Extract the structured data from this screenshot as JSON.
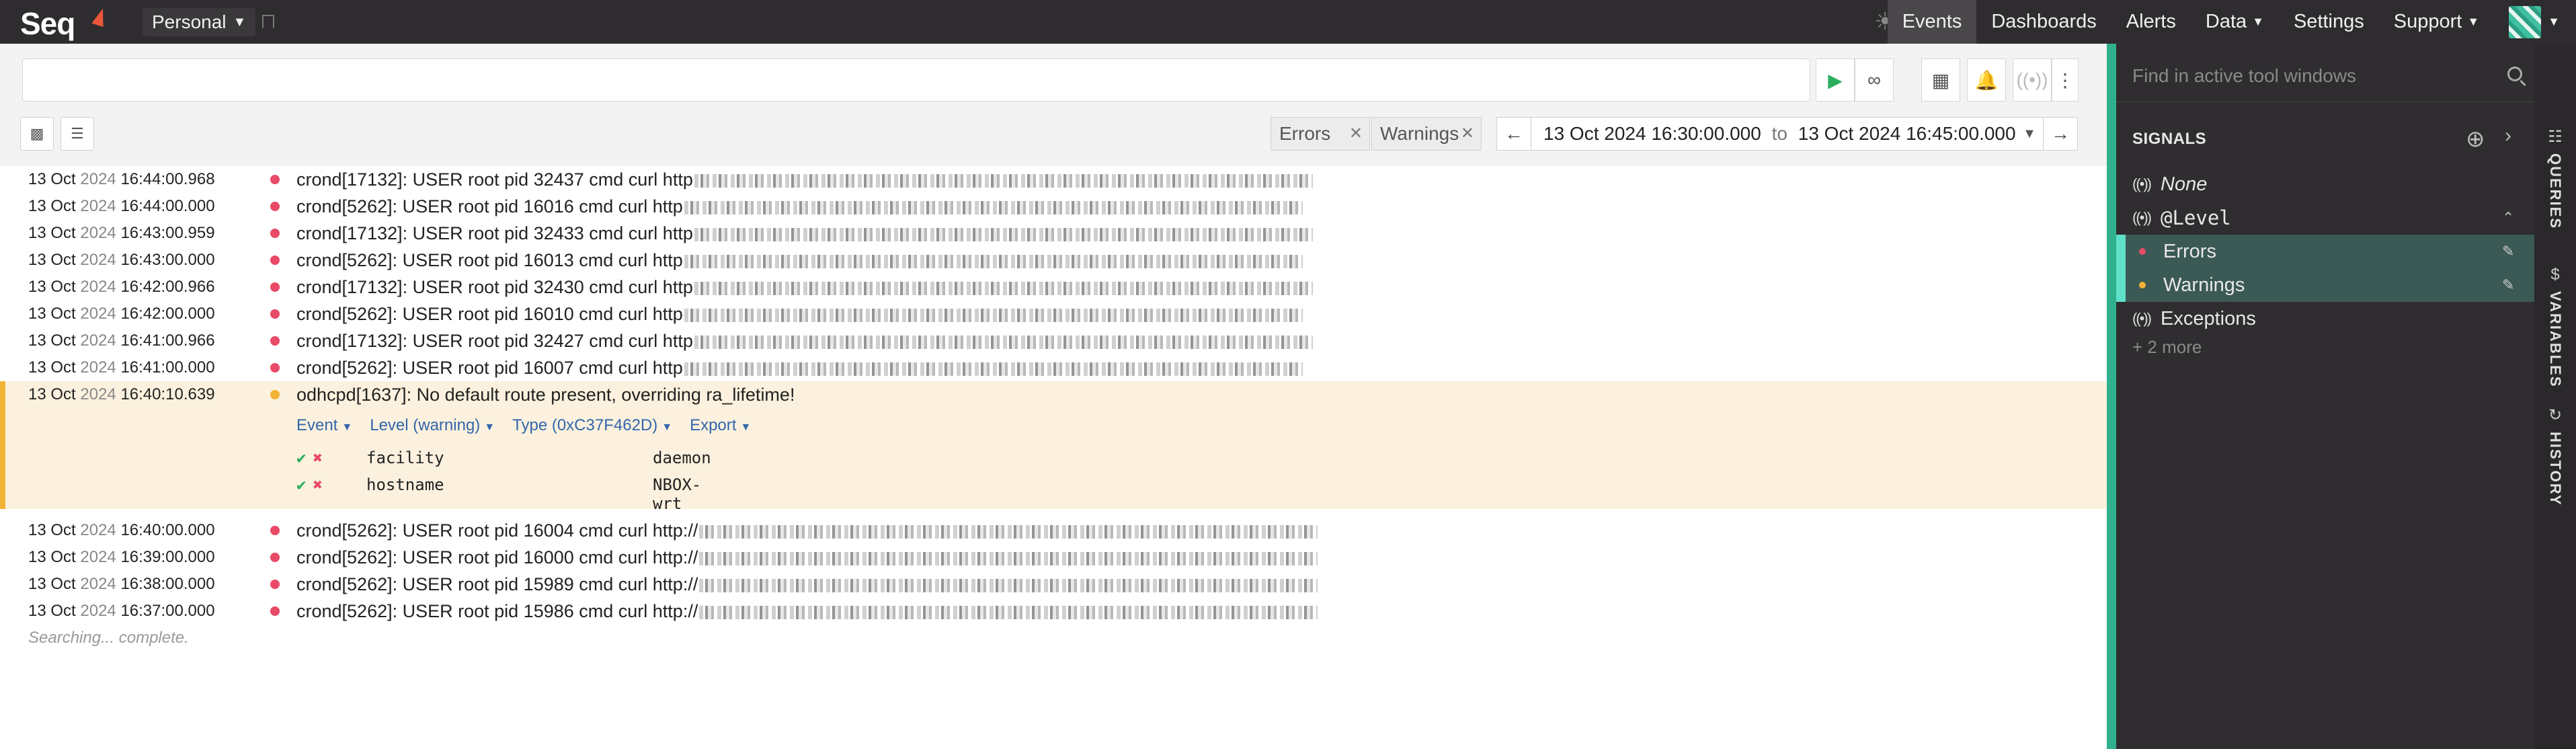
{
  "app": {
    "logo": "Seq",
    "workspace": "Personal"
  },
  "nav": {
    "events": "Events",
    "dashboards": "Dashboards",
    "alerts": "Alerts",
    "data": "Data",
    "settings": "Settings",
    "support": "Support"
  },
  "filters": {
    "search_value": "",
    "chip_errors": "Errors",
    "chip_warnings": "Warnings",
    "range_from": "13 Oct 2024 16:30:00.000",
    "range_to_word": "to",
    "range_to": "13 Oct 2024 16:45:00.000"
  },
  "events": [
    {
      "date": "13 Oct",
      "year": "2024",
      "time": "16:44:00.968",
      "level": "error",
      "message": "crond[17132]: USER root pid 32437 cmd curl http"
    },
    {
      "date": "13 Oct",
      "year": "2024",
      "time": "16:44:00.000",
      "level": "error",
      "message": "crond[5262]: USER root pid 16016 cmd curl http"
    },
    {
      "date": "13 Oct",
      "year": "2024",
      "time": "16:43:00.959",
      "level": "error",
      "message": "crond[17132]: USER root pid 32433 cmd curl http"
    },
    {
      "date": "13 Oct",
      "year": "2024",
      "time": "16:43:00.000",
      "level": "error",
      "message": "crond[5262]: USER root pid 16013 cmd curl http"
    },
    {
      "date": "13 Oct",
      "year": "2024",
      "time": "16:42:00.966",
      "level": "error",
      "message": "crond[17132]: USER root pid 32430 cmd curl http"
    },
    {
      "date": "13 Oct",
      "year": "2024",
      "time": "16:42:00.000",
      "level": "error",
      "message": "crond[5262]: USER root pid 16010 cmd curl http"
    },
    {
      "date": "13 Oct",
      "year": "2024",
      "time": "16:41:00.966",
      "level": "error",
      "message": "crond[17132]: USER root pid 32427 cmd curl http"
    },
    {
      "date": "13 Oct",
      "year": "2024",
      "time": "16:41:00.000",
      "level": "error",
      "message": "crond[5262]: USER root pid 16007 cmd curl http"
    }
  ],
  "expanded_event": {
    "date": "13 Oct",
    "year": "2024",
    "time": "16:40:10.639",
    "level": "warning",
    "message": "odhcpd[1637]: No default route present, overriding ra_lifetime!",
    "actions": {
      "event": "Event",
      "level": "Level (warning)",
      "type": "Type (0xC37F462D)",
      "export": "Export"
    },
    "properties": [
      {
        "key": "facility",
        "value": "daemon"
      },
      {
        "key": "hostname",
        "value": "NBOX-wrt"
      }
    ]
  },
  "events_after": [
    {
      "date": "13 Oct",
      "year": "2024",
      "time": "16:40:00.000",
      "level": "error",
      "message": "crond[5262]: USER root pid 16004 cmd curl http://"
    },
    {
      "date": "13 Oct",
      "year": "2024",
      "time": "16:39:00.000",
      "level": "error",
      "message": "crond[5262]: USER root pid 16000 cmd curl http://"
    },
    {
      "date": "13 Oct",
      "year": "2024",
      "time": "16:38:00.000",
      "level": "error",
      "message": "crond[5262]: USER root pid 15989 cmd curl http://"
    },
    {
      "date": "13 Oct",
      "year": "2024",
      "time": "16:37:00.000",
      "level": "error",
      "message": "crond[5262]: USER root pid 15986 cmd curl http://"
    }
  ],
  "status": "Searching... complete.",
  "panel": {
    "search_placeholder": "Find in active tool windows",
    "signals_heading": "SIGNALS",
    "signal_none": "None",
    "signal_level": "@Level",
    "signal_errors": "Errors",
    "signal_warnings": "Warnings",
    "signal_exceptions": "Exceptions",
    "more": "+ 2 more",
    "tab_queries": "QUERIES",
    "tab_variables": "VARIABLES",
    "tab_history": "HISTORY"
  },
  "colors": {
    "error": "#e84a67",
    "warning": "#f2b233",
    "accent": "#31b08e"
  }
}
